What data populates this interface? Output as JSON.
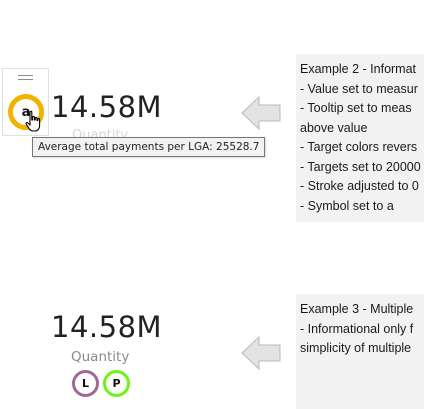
{
  "example2_visual": {
    "value": "14.58M",
    "category_label": "Quantity",
    "symbol": "a",
    "symbol_ring_color": "#f2b300",
    "tooltip": "Average total payments per LGA: 25528.7"
  },
  "example3_visual": {
    "value": "14.58M",
    "category_label": "Quantity",
    "symbols": [
      {
        "letter": "L",
        "ring_color": "#a0679a"
      },
      {
        "letter": "P",
        "ring_color": "#6ef21a"
      }
    ]
  },
  "notes_example2": {
    "lines": [
      "Example 2 - Informat",
      "- Value set to measur",
      "- Tooltip set to meas",
      "above value",
      "- Target colors revers",
      "- Targets set to 20000",
      "- Stroke adjusted to 0",
      "- Symbol set to a"
    ]
  },
  "notes_example3": {
    "lines": [
      "Example 3 - Multiple",
      "- Informational only f",
      "simplicity of multiple"
    ]
  },
  "arrow_color": "#e3e3e3",
  "arrow_border_color": "#b9b9b9"
}
